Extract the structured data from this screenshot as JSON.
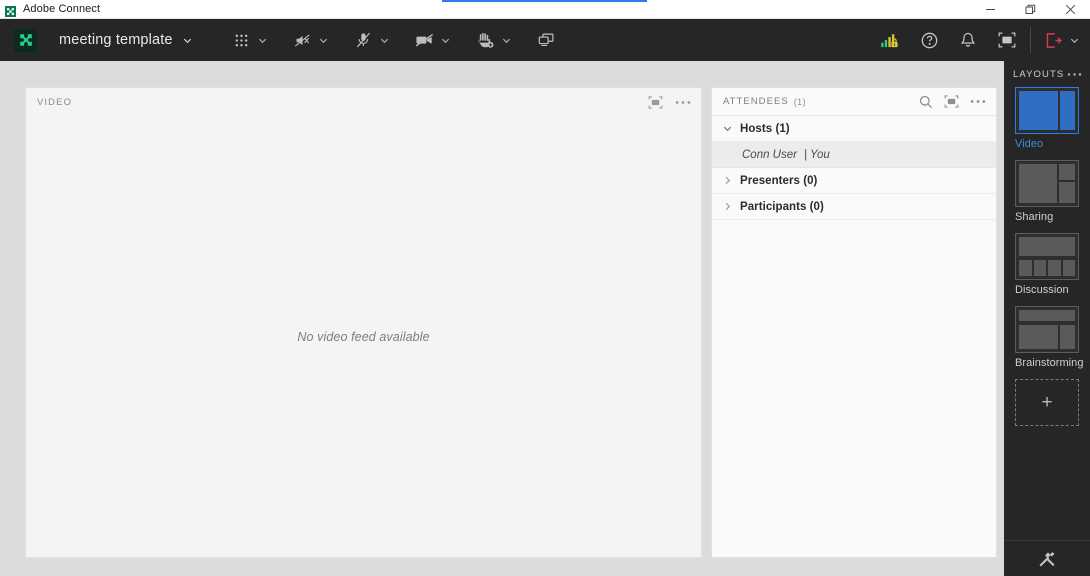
{
  "window": {
    "title": "Adobe Connect",
    "app_icon": "adobe-connect-logo-icon",
    "controls": {
      "minimize": "minimize-icon",
      "restore": "restore-icon",
      "close": "close-icon"
    },
    "accent_color": "#2b7de9"
  },
  "toolbar": {
    "logo_icon": "adobe-connect-logo-icon",
    "meeting_name": "meeting template",
    "meeting_chevron": "chevron-down-icon",
    "tools": [
      {
        "icon": "apps-grid-icon",
        "label": "Pods",
        "has_chevron": true,
        "state": "off"
      },
      {
        "icon": "speaker-muted-icon",
        "label": "Speaker",
        "has_chevron": true,
        "state": "muted"
      },
      {
        "icon": "microphone-muted-icon",
        "label": "Microphone",
        "has_chevron": true,
        "state": "muted"
      },
      {
        "icon": "camera-off-icon",
        "label": "Camera",
        "has_chevron": true,
        "state": "off"
      },
      {
        "icon": "raise-hand-icon",
        "label": "Raise Hand",
        "has_chevron": true,
        "state": "off"
      },
      {
        "icon": "screen-share-icon",
        "label": "Share Screen",
        "has_chevron": false,
        "state": "off"
      }
    ],
    "right_tools": [
      {
        "icon": "network-signal-lock-icon",
        "label": "Connection Status"
      },
      {
        "icon": "help-question-icon",
        "label": "Help"
      },
      {
        "icon": "bell-notification-icon",
        "label": "Notifications"
      },
      {
        "icon": "fullscreen-icon",
        "label": "Full Screen"
      }
    ],
    "exit": {
      "icon": "exit-meeting-icon",
      "chevron": "chevron-down-icon",
      "color": "#e0364f"
    }
  },
  "video_pod": {
    "title": "VIDEO",
    "fullscreen_icon": "fullscreen-icon",
    "menu_icon": "more-options-icon",
    "empty_message": "No video feed available"
  },
  "attendees_pod": {
    "title": "ATTENDEES",
    "count": "(1)",
    "search_icon": "search-icon",
    "fullscreen_icon": "fullscreen-icon",
    "menu_icon": "more-options-icon",
    "groups": [
      {
        "label": "Hosts (1)",
        "expanded": true,
        "arrow": "chevron-down-icon",
        "members": [
          {
            "name": "Conn User",
            "tag": "| You",
            "selected": true
          }
        ]
      },
      {
        "label": "Presenters (0)",
        "expanded": false,
        "arrow": "chevron-right-icon",
        "members": []
      },
      {
        "label": "Participants (0)",
        "expanded": false,
        "arrow": "chevron-right-icon",
        "members": []
      }
    ]
  },
  "layouts_rail": {
    "title": "LAYOUTS",
    "menu_icon": "more-options-icon",
    "items": [
      {
        "name": "Video",
        "selected": true,
        "thumb": "video"
      },
      {
        "name": "Sharing",
        "selected": false,
        "thumb": "sharing"
      },
      {
        "name": "Discussion",
        "selected": false,
        "thumb": "discussion"
      },
      {
        "name": "Brainstorming",
        "selected": false,
        "thumb": "brainstorming"
      }
    ],
    "add_label": "+",
    "add_icon": "add-layout-icon",
    "prepare_icon": "prepare-mode-tools-icon",
    "selected_color": "#3c8ae0"
  }
}
